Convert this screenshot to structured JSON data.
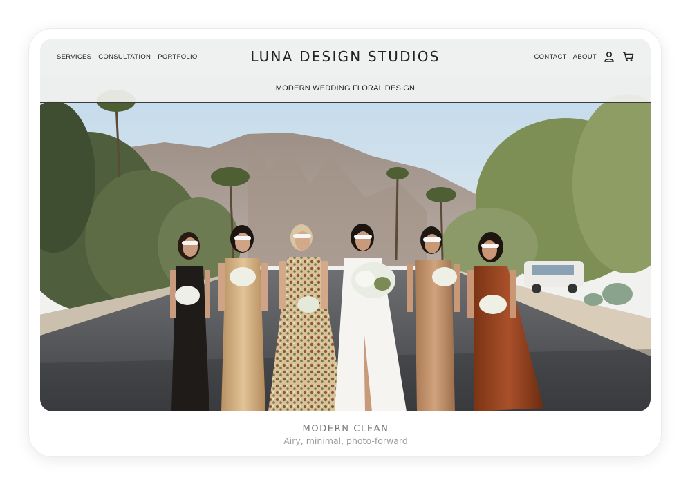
{
  "header": {
    "brand": "LUNA DESIGN STUDIOS",
    "nav_left": [
      "SERVICES",
      "CONSULTATION",
      "PORTFOLIO"
    ],
    "nav_right": [
      "CONTACT",
      "ABOUT"
    ],
    "icons": [
      "user-icon",
      "cart-icon"
    ]
  },
  "subheader": {
    "tagline": "MODERN WEDDING FLORAL DESIGN"
  },
  "hero": {
    "image": "bridal party in sunglasses walking down a desert street with palm trees and mountains"
  },
  "caption": {
    "title": "MODERN CLEAN",
    "subtitle": "Airy, minimal, photo-forward"
  },
  "colors": {
    "text_dark": "#222222",
    "header_bg": "#f3f3f1",
    "caption_title": "#777777",
    "caption_sub": "#9b9b9b"
  }
}
